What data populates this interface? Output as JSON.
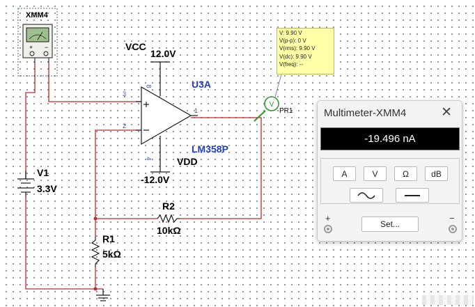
{
  "schematic": {
    "xmm_label": "XMM4",
    "vcc_label": "VCC",
    "vcc_value": "12.0V",
    "vdd_label": "VDD",
    "vdd_value": "-12.0V",
    "opamp_ref": "U3A",
    "opamp_model": "LM358P",
    "pin_3": "3",
    "pin_2": "2",
    "pin_1": "1",
    "pin_8": "8",
    "pin_4": "4",
    "v1_label": "V1",
    "v1_value": "3.3V",
    "r1_label": "R1",
    "r1_value": "5kΩ",
    "r2_label": "R2",
    "r2_value": "10kΩ",
    "probe_label": "PR1",
    "probe_symbol": "V",
    "probe_info": [
      "V: 9.90 V",
      "V(p-p): 0 V",
      "V(rms): 9.90 V",
      "V(dc): 9.90 V",
      "V(freq): --"
    ]
  },
  "multimeter": {
    "title": "Multimeter-XMM4",
    "close": "✕",
    "reading": "-19.496 nA",
    "mode_buttons": [
      "A",
      "V",
      "Ω",
      "dB"
    ],
    "ac_symbol": "~",
    "dc_symbol": "—",
    "set_label": "Set...",
    "plus": "+",
    "minus": "−"
  },
  "colors": {
    "wire": "#c0282c",
    "component": "#1a1a1a",
    "label_blue": "#1f3fbf",
    "probe_green": "#2f9a2f"
  },
  "icons": {
    "ac_mode": "sine-wave-icon",
    "dc_mode": "dc-line-icon",
    "probe": "voltage-probe-icon",
    "ground": "ground-icon"
  }
}
